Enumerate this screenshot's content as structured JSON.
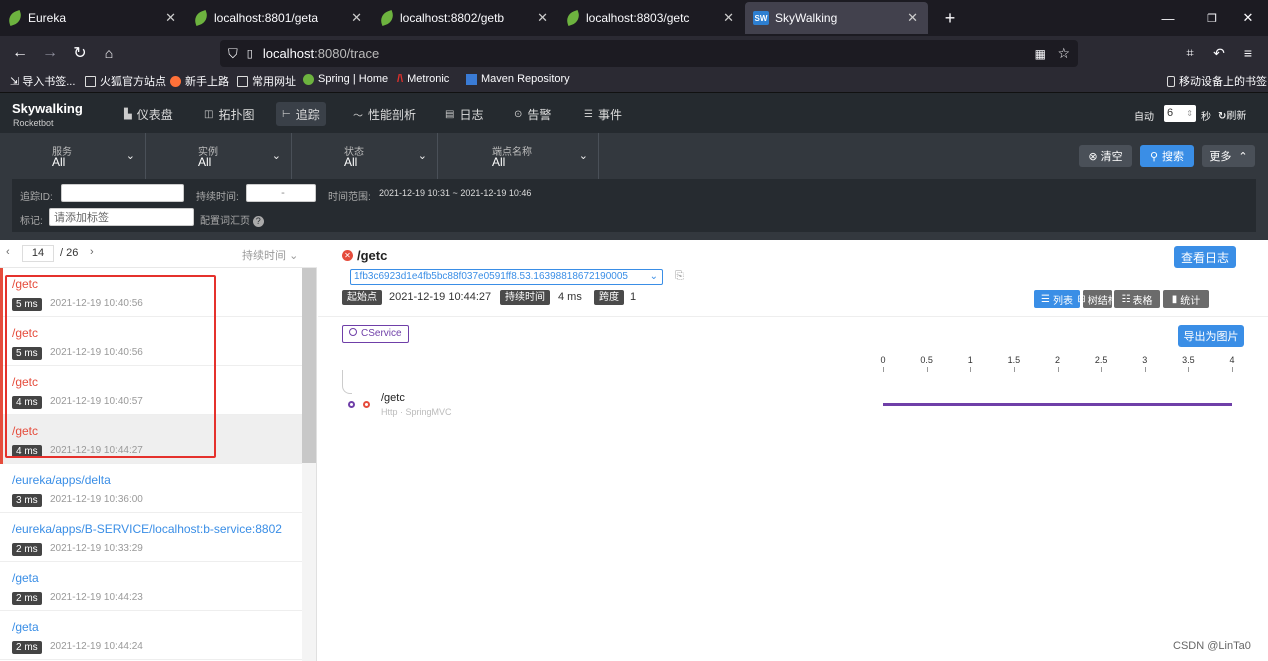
{
  "browser": {
    "tabs": [
      {
        "title": "Eureka",
        "icon": "spring-leaf-icon"
      },
      {
        "title": "localhost:8801/geta",
        "icon": "spring-leaf-icon"
      },
      {
        "title": "localhost:8802/getb",
        "icon": "spring-leaf-icon"
      },
      {
        "title": "localhost:8803/getc",
        "icon": "spring-leaf-icon"
      },
      {
        "title": "SkyWalking",
        "icon": "skywalking-icon",
        "active": true
      }
    ],
    "url_host": "localhost",
    "url_rest": ":8080/trace",
    "bookmarks": [
      "导入书签...",
      "火狐官方站点",
      "新手上路",
      "常用网址",
      "Spring | Home",
      "Metronic",
      "Maven Repository"
    ],
    "mobile_bookmarks": "移动设备上的书签"
  },
  "app": {
    "logo_line1": "Skywalking",
    "logo_line2": "Rocketbot",
    "nav": [
      "仪表盘",
      "拓扑图",
      "追踪",
      "性能剖析",
      "日志",
      "告警",
      "事件"
    ],
    "auto_label": "自动",
    "auto_value": "6",
    "seconds_label": "秒",
    "refresh_label": "刷新"
  },
  "filters": {
    "selects": [
      {
        "label": "服务",
        "value": "All"
      },
      {
        "label": "实例",
        "value": "All"
      },
      {
        "label": "状态",
        "value": "All"
      },
      {
        "label": "端点名称",
        "value": "All"
      }
    ],
    "clear_label": "清空",
    "search_label": "搜索",
    "more_label": "更多",
    "trace_id_label": "追踪ID:",
    "duration_label": "持续时间:",
    "duration_sep": "-",
    "time_range_label": "时间范围:",
    "time_range_value": "2021-12-19 10:31 ~ 2021-12-19 10:46",
    "tags_label": "标记:",
    "tags_placeholder": "请添加标签",
    "config_vocab": "配置词汇页"
  },
  "list": {
    "page": "14",
    "total": "/ 26",
    "sort_label": "持续时间",
    "items": [
      {
        "name": "/getc",
        "duration": "5 ms",
        "time": "2021-12-19 10:40:56",
        "error": true
      },
      {
        "name": "/getc",
        "duration": "5 ms",
        "time": "2021-12-19 10:40:56",
        "error": true
      },
      {
        "name": "/getc",
        "duration": "4 ms",
        "time": "2021-12-19 10:40:57",
        "error": true
      },
      {
        "name": "/getc",
        "duration": "4 ms",
        "time": "2021-12-19 10:44:27",
        "error": true,
        "selected": true
      },
      {
        "name": "/eureka/apps/delta",
        "duration": "3 ms",
        "time": "2021-12-19 10:36:00",
        "error": false
      },
      {
        "name": "/eureka/apps/B-SERVICE/localhost:b-service:8802",
        "duration": "2 ms",
        "time": "2021-12-19 10:33:29",
        "error": false
      },
      {
        "name": "/geta",
        "duration": "2 ms",
        "time": "2021-12-19 10:44:23",
        "error": false
      },
      {
        "name": "/geta",
        "duration": "2 ms",
        "time": "2021-12-19 10:44:24",
        "error": false
      }
    ]
  },
  "detail": {
    "title": "/getc",
    "view_logs": "查看日志",
    "trace_id": "1fb3c6923d1e4fb5bc88f037e0591ff8.53.16398818672190005",
    "start_label": "起始点",
    "start_value": "2021-12-19 10:44:27",
    "duration_label": "持续时间",
    "duration_value": "4 ms",
    "span_label": "跨度",
    "span_value": "1",
    "views": [
      "列表",
      "树结构",
      "表格",
      "统计"
    ],
    "service_tag": "CService",
    "export_label": "导出为图片",
    "axis_ticks": [
      "0",
      "0.5",
      "1",
      "1.5",
      "2",
      "2.5",
      "3",
      "3.5",
      "4"
    ],
    "span_name": "/getc",
    "span_sub": "Http · SpringMVC",
    "span_bar_fraction": 1.0,
    "watermark": "CSDN @LinTa0"
  },
  "colors": {
    "accent": "#3a8ee6",
    "error": "#e54c3c",
    "link": "#3a8ee6",
    "span_bar": "#6f3fa8"
  }
}
